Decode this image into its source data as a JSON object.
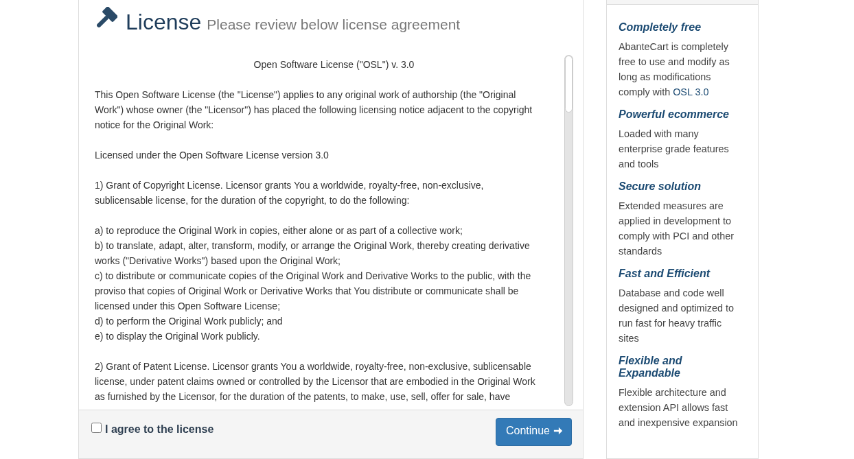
{
  "header": {
    "title": "License",
    "subtitle": "Please review below license agreement"
  },
  "license": {
    "heading": "Open Software License (\"OSL\") v. 3.0",
    "paragraphs": [
      {
        "lines": [
          "This Open Software License (the \"License\") applies to any original work of authorship (the \"Original",
          "Work\") whose owner (the \"Licensor\") has placed the following licensing notice adjacent to the copyright",
          "notice for the Original Work:"
        ]
      },
      {
        "lines": [
          "Licensed under the Open Software License version 3.0"
        ]
      },
      {
        "lines": [
          "1) Grant of Copyright License. Licensor grants You a worldwide, royalty-free, non-exclusive,",
          "sublicensable license, for the duration of the copyright, to do the following:"
        ]
      },
      {
        "lines": [
          "a) to reproduce the Original Work in copies, either alone or as part of a collective work;",
          "b) to translate, adapt, alter, transform, modify, or arrange the Original Work, thereby creating derivative",
          "works (\"Derivative Works\") based upon the Original Work;",
          "c) to distribute or communicate copies of the Original Work and Derivative Works to the public, with the",
          "proviso that copies of Original Work or Derivative Works that You distribute or communicate shall be",
          "licensed under this Open Software License;",
          "d) to perform the Original Work publicly; and",
          "e) to display the Original Work publicly."
        ]
      },
      {
        "lines": [
          "2) Grant of Patent License. Licensor grants You a worldwide, royalty-free, non-exclusive, sublicensable",
          "license, under patent claims owned or controlled by the Licensor that are embodied in the Original Work",
          "as furnished by the Licensor, for the duration of the patents, to make, use, sell, offer for sale, have"
        ]
      }
    ]
  },
  "agree": {
    "label": "I agree to the license",
    "checked": false
  },
  "continue_button": {
    "label": "Continue"
  },
  "features": [
    {
      "title": "Completely free",
      "parts": [
        {
          "kind": "text",
          "text": "AbanteCart is completely free to use and modify as long as modifications comply with "
        },
        {
          "kind": "link",
          "text": "OSL 3.0"
        }
      ]
    },
    {
      "title": "Powerful ecommerce",
      "parts": [
        {
          "kind": "text",
          "text": "Loaded with many enterprise grade features and tools"
        }
      ]
    },
    {
      "title": "Secure solution",
      "parts": [
        {
          "kind": "text",
          "text": "Extended measures are applied in development to comply with PCI and other standards"
        }
      ]
    },
    {
      "title": "Fast and Efficient",
      "parts": [
        {
          "kind": "text",
          "text": "Database and code well designed and optimized to run fast for heavy traffic sites"
        }
      ]
    },
    {
      "title": "Flexible and Expandable",
      "parts": [
        {
          "kind": "text",
          "text": "Flexible architecture and extension API allows fast and inexpensive expansion"
        }
      ]
    }
  ]
}
